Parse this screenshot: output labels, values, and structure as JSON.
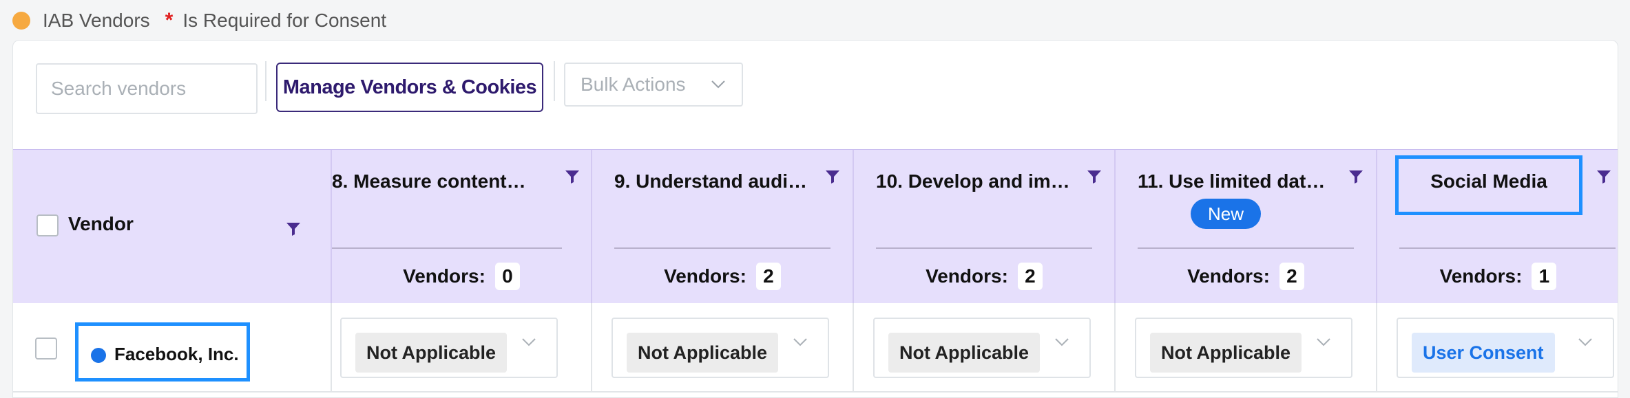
{
  "legend": {
    "dot_color": "#f6a940",
    "iab_label": "IAB Vendors",
    "star": "*",
    "star_color": "#e02020",
    "required_label": "Is Required for Consent"
  },
  "toolbar": {
    "search_placeholder": "Search vendors",
    "search_icon": "search-icon",
    "manage_label": "Manage Vendors & Cookies",
    "bulk_label": "Bulk Actions"
  },
  "table": {
    "vendor_header": "Vendor",
    "columns": [
      {
        "title": "8. Measure content…",
        "vendors_label": "Vendors:",
        "count": "0",
        "badge": ""
      },
      {
        "title": "9. Understand audi…",
        "vendors_label": "Vendors:",
        "count": "2",
        "badge": ""
      },
      {
        "title": "10. Develop and im…",
        "vendors_label": "Vendors:",
        "count": "2",
        "badge": ""
      },
      {
        "title": "11. Use limited dat…",
        "vendors_label": "Vendors:",
        "count": "2",
        "badge": "New"
      },
      {
        "title": "Social Media",
        "vendors_label": "Vendors:",
        "count": "1",
        "badge": ""
      }
    ],
    "rows": [
      {
        "vendor": "Facebook, Inc.",
        "values": [
          "Not Applicable",
          "Not Applicable",
          "Not Applicable",
          "Not Applicable",
          "User Consent"
        ]
      }
    ]
  },
  "colors": {
    "header_bg": "#e6dffc",
    "accent": "#2e1a6d",
    "highlight": "#1e90ff",
    "filter_icon": "#4a2c8f"
  }
}
